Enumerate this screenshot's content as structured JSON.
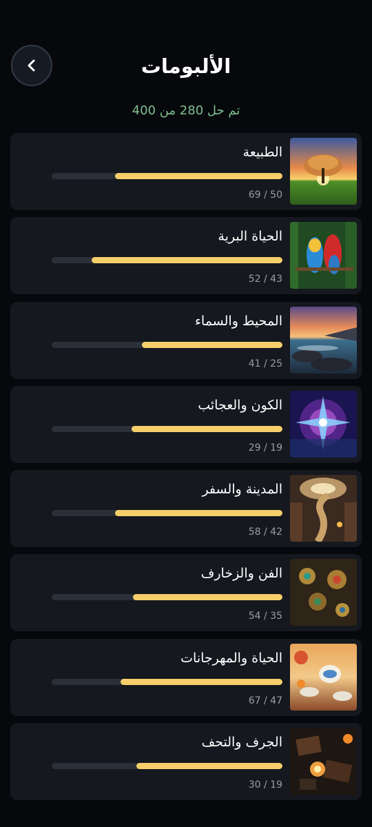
{
  "header": {
    "title": "الألبومات",
    "summary": "تم حل 280 من 400"
  },
  "colors": {
    "background": "#06080c",
    "card": "#15181e",
    "progress_fill": "#f6cf6b",
    "progress_track": "#2b2f37",
    "summary_text": "#7fc08f"
  },
  "albums": [
    {
      "name": "الطبيعة",
      "solved": 50,
      "total": 69,
      "count_label": "69 / 50",
      "thumb_icon": "tree-sunset-image"
    },
    {
      "name": "الحياة البرية",
      "solved": 43,
      "total": 52,
      "count_label": "52 / 43",
      "thumb_icon": "parrots-image"
    },
    {
      "name": "المحيط والسماء",
      "solved": 25,
      "total": 41,
      "count_label": "41 / 25",
      "thumb_icon": "coast-sunset-image"
    },
    {
      "name": "الكون والعجائب",
      "solved": 19,
      "total": 29,
      "count_label": "29 / 19",
      "thumb_icon": "cosmic-star-image"
    },
    {
      "name": "المدينة والسفر",
      "solved": 42,
      "total": 58,
      "count_label": "58 / 42",
      "thumb_icon": "library-staircase-image"
    },
    {
      "name": "الفن والزخارف",
      "solved": 35,
      "total": 54,
      "count_label": "54 / 35",
      "thumb_icon": "ornaments-image"
    },
    {
      "name": "الحياة والمهرجانات",
      "solved": 47,
      "total": 67,
      "count_label": "67 / 47",
      "thumb_icon": "tea-party-image"
    },
    {
      "name": "الجرف والتحف",
      "solved": 19,
      "total": 30,
      "count_label": "30 / 19",
      "thumb_icon": "antiques-image"
    }
  ]
}
